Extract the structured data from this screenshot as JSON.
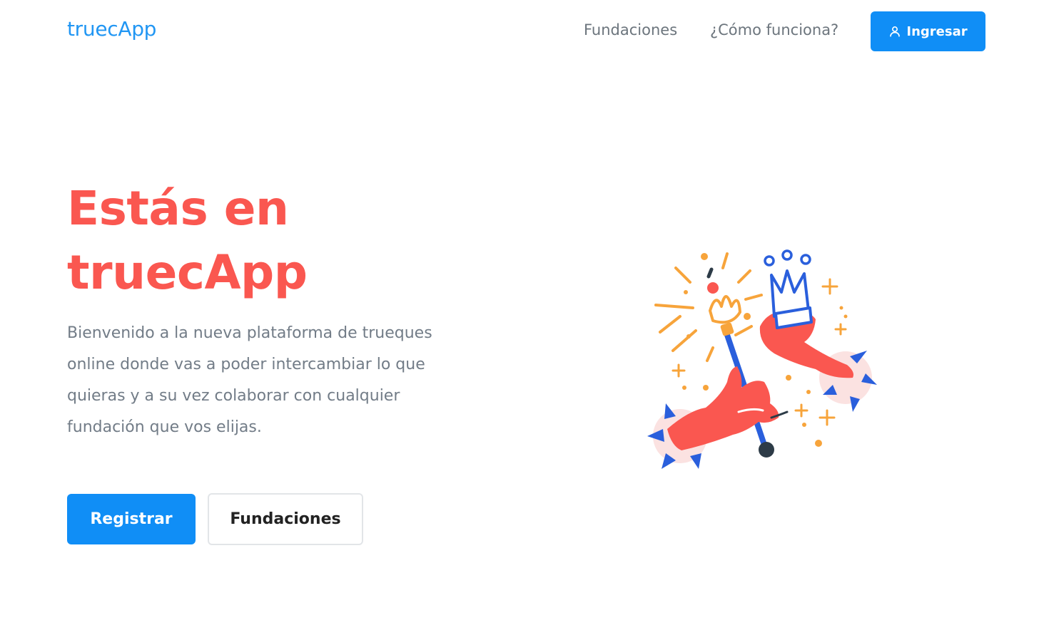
{
  "navbar": {
    "brand": "truecApp",
    "links": [
      "Fundaciones",
      "¿Cómo funciona?"
    ],
    "login_label": "Ingresar"
  },
  "hero": {
    "title": "Estás en truecApp",
    "description": "Bienvenido a la nueva plataforma de trueques online donde vas a poder intercambiar lo que quieras y a su vez colaborar con cualquier fundación que vos elijas.",
    "primary_button": "Registrar",
    "secondary_button": "Fundaciones"
  },
  "icons": {
    "login": "user-icon",
    "illustration": "hands-exchanging-crown-and-scepter-illustration"
  },
  "colors": {
    "brand_blue": "#2196f3",
    "button_blue": "#108ef6",
    "title_red": "#fa5750",
    "text_gray": "#727c87",
    "accent_orange": "#f7a43b"
  }
}
